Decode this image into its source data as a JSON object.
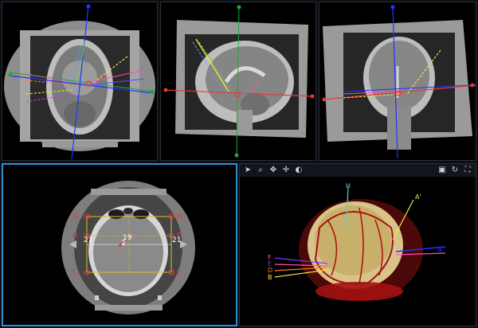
{
  "axial_ct": {
    "point_labels": [
      "A",
      "B",
      "C",
      "D",
      "E",
      "F"
    ],
    "left_measure": "21",
    "right_measure": "21",
    "center_measure_top": "19",
    "center_measure_mid": "2"
  },
  "render3d": {
    "labels": [
      "H",
      "A'",
      "F",
      "E",
      "D",
      "B",
      "B'"
    ]
  },
  "toolbar": {
    "tools": [
      "select-arrow",
      "zoom",
      "pan",
      "move",
      "contrast"
    ],
    "view_tools": [
      "layout",
      "rotate",
      "fullscreen"
    ]
  },
  "colors": {
    "active_border": "#2e8fd6",
    "point_red": "#e23a3a",
    "vessel_red": "#c41818",
    "brain_gold": "#d8c489"
  }
}
